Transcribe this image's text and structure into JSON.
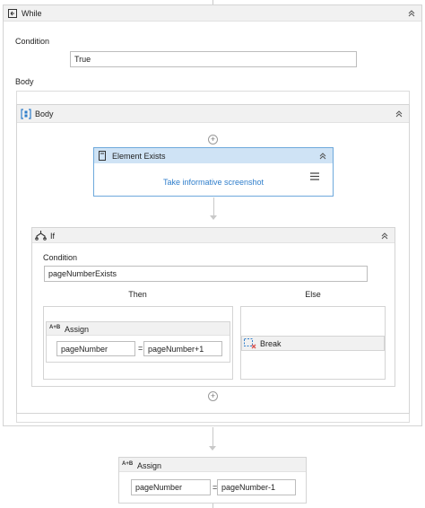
{
  "while": {
    "title": "While",
    "condition_label": "Condition",
    "condition_value": "True",
    "body_label": "Body"
  },
  "body_sequence": {
    "title": "Body"
  },
  "element_exists": {
    "title": "Element Exists",
    "link": "Take informative screenshot"
  },
  "if_activity": {
    "title": "If",
    "condition_label": "Condition",
    "condition_value": "pageNumberExists",
    "then_label": "Then",
    "else_label": "Else"
  },
  "then_assign": {
    "icon_text": "A+B",
    "title": "Assign",
    "left": "pageNumber",
    "eq": "=",
    "right": "pageNumber+1"
  },
  "break_activity": {
    "title": "Break"
  },
  "bottom_assign": {
    "icon_text": "A+B",
    "title": "Assign",
    "left": "pageNumber",
    "eq": "=",
    "right": "pageNumber-1"
  },
  "colors": {
    "header_bg": "#f1f1f1",
    "selected_header": "#cfe3f5",
    "selected_border": "#6ea9dc",
    "link": "#2f7ecb",
    "break_icon": "#d9534f"
  },
  "icons": [
    "while-icon",
    "sequence-icon",
    "element-exists-icon",
    "menu-icon",
    "if-icon",
    "assign-icon",
    "break-icon",
    "collapse-icon",
    "add-icon"
  ]
}
